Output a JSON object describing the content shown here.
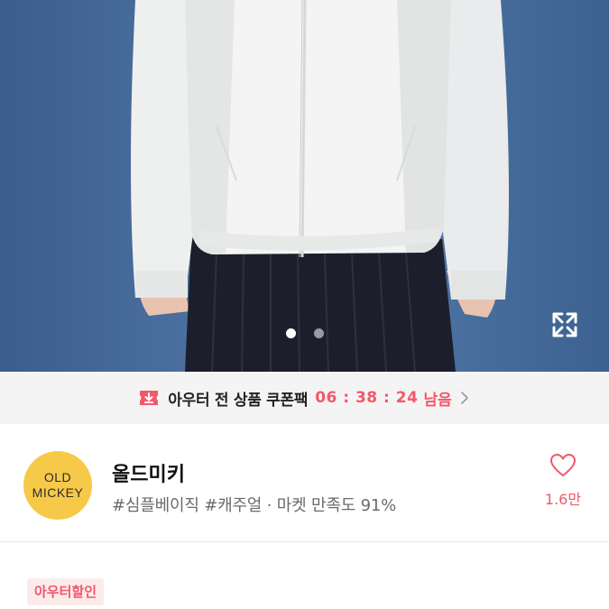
{
  "gallery": {
    "image_alt": "product-photo",
    "slide_count": 2,
    "active_slide": 1,
    "expand_icon": "expand-icon"
  },
  "coupon": {
    "label": "아우터 전 상품 쿠폰팩",
    "timer": "06 : 38 : 24",
    "suffix": "남음",
    "icon": "coupon-download-icon",
    "accent": "#f2586a"
  },
  "shop": {
    "logo_line1": "OLD",
    "logo_line2": "MICKEY",
    "logo_color": "#f6c948",
    "name": "올드미키",
    "tags": "#심플베이직 #캐주얼 · 마켓 만족도 91%",
    "likes": "1.6만",
    "like_icon": "heart-icon"
  },
  "badge": {
    "label": "아우터할인"
  }
}
